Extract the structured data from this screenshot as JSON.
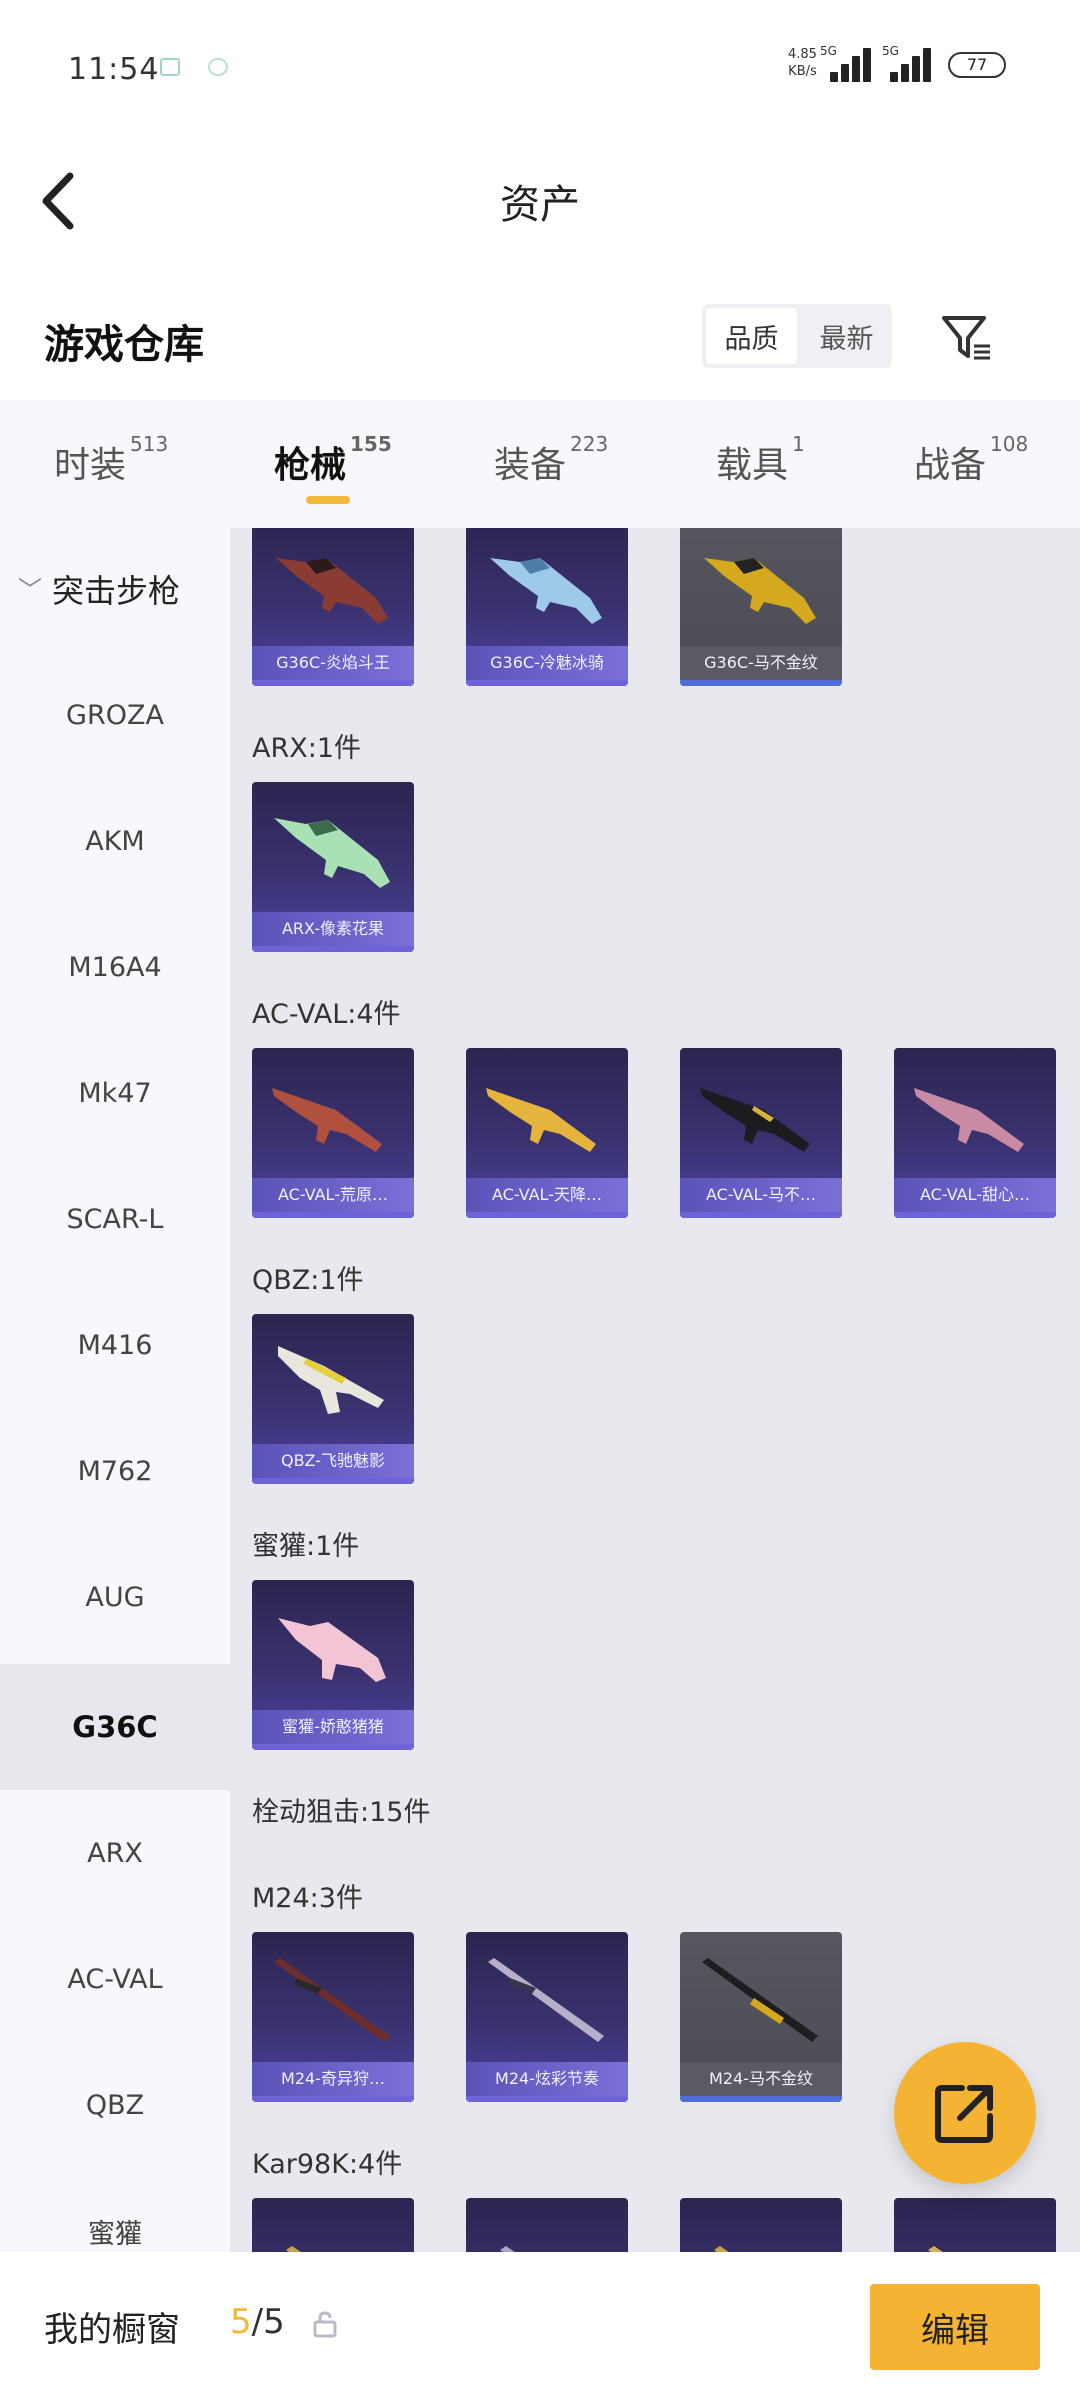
{
  "status_bar": {
    "time": "11:54",
    "speed_value": "4.85",
    "speed_unit": "KB/s",
    "net1": "5G",
    "net2": "5G",
    "battery": "77"
  },
  "header": {
    "title": "资产"
  },
  "warehouse": {
    "title": "游戏仓库",
    "sort_options": [
      "品质",
      "最新"
    ]
  },
  "tabs": [
    {
      "label": "时装",
      "count": "513"
    },
    {
      "label": "枪械",
      "count": "155"
    },
    {
      "label": "装备",
      "count": "223"
    },
    {
      "label": "载具",
      "count": "1"
    },
    {
      "label": "战备",
      "count": "108"
    }
  ],
  "sidebar": {
    "group": "突击步枪",
    "items": [
      "GROZA",
      "AKM",
      "M16A4",
      "Mk47",
      "SCAR-L",
      "M416",
      "M762",
      "AUG",
      "G36C",
      "ARX",
      "AC-VAL",
      "QBZ",
      "蜜獾"
    ],
    "active": "G36C"
  },
  "content": {
    "g36c_cards": [
      "G36C-炎焰斗王",
      "G36C-冷魅冰骑",
      "G36C-马不金纹"
    ],
    "sections": [
      {
        "label": "ARX:1件",
        "cards": [
          "ARX-像素花果"
        ]
      },
      {
        "label": "AC-VAL:4件",
        "cards": [
          "AC-VAL-荒原…",
          "AC-VAL-天降…",
          "AC-VAL-马不…",
          "AC-VAL-甜心…"
        ]
      },
      {
        "label": "QBZ:1件",
        "cards": [
          "QBZ-飞驰魅影"
        ]
      },
      {
        "label": "蜜獾:1件",
        "cards": [
          "蜜獾-娇憨猪猪"
        ]
      },
      {
        "label": "栓动狙击:15件",
        "cards": []
      },
      {
        "label": "M24:3件",
        "cards": [
          "M24-奇异狩…",
          "M24-炫彩节奏",
          "M24-马不金纹"
        ]
      },
      {
        "label": "Kar98K:4件",
        "cards": []
      }
    ]
  },
  "bottom_bar": {
    "label": "我的橱窗",
    "current": "5",
    "total": "/5",
    "edit_label": "编辑"
  },
  "colors": {
    "accent": "#f5b333",
    "card_purple": "#3a3270",
    "card_gold": "#505058",
    "content_bg": "#e7e9ef"
  }
}
